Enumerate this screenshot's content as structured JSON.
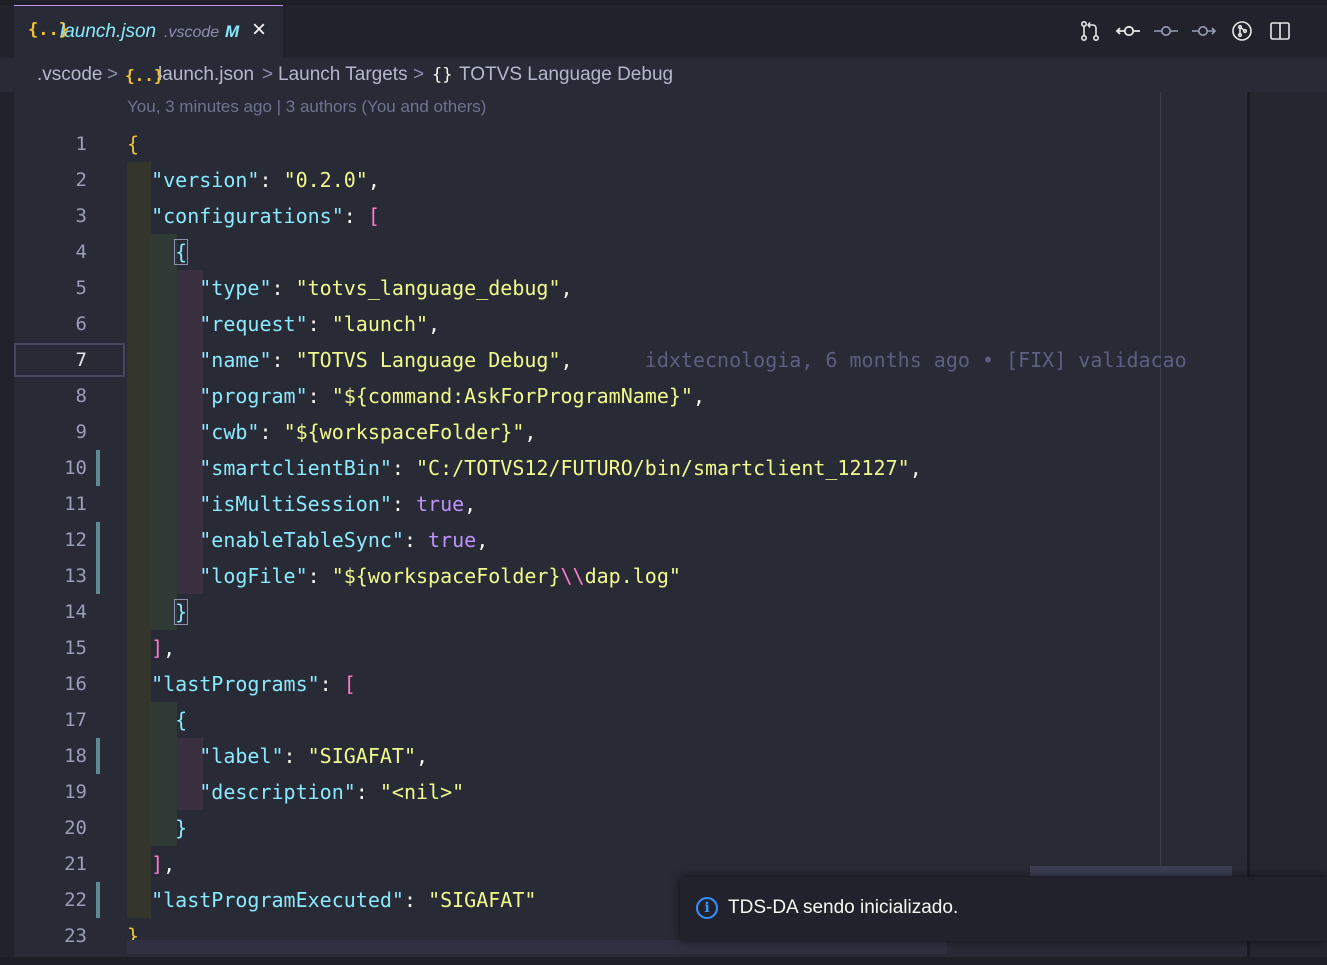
{
  "tab": {
    "icon": "{..}",
    "file": "launch.json",
    "folder": ".vscode",
    "status": "M",
    "close": "×"
  },
  "actions": [
    {
      "name": "open-changes-icon"
    },
    {
      "name": "git-commit-icon"
    },
    {
      "name": "previous-change-icon"
    },
    {
      "name": "next-change-icon"
    },
    {
      "name": "timeline-icon"
    },
    {
      "name": "split-editor-icon"
    }
  ],
  "breadcrumb": {
    "folder": ".vscode",
    "file_icon": "{..}",
    "file": "launch.json",
    "section": "Launch Targets",
    "item_icon": "{}",
    "item": "TOTVS Language Debug",
    "sep": ">"
  },
  "codelens": "You, 3 minutes ago | 3 authors (You and others)",
  "blame": "idxtecnologia, 6 months ago • [FIX] validacao",
  "line_numbers": [
    "1",
    "2",
    "3",
    "4",
    "5",
    "6",
    "7",
    "8",
    "9",
    "10",
    "11",
    "12",
    "13",
    "14",
    "15",
    "16",
    "17",
    "18",
    "19",
    "20",
    "21",
    "22",
    "23"
  ],
  "code": {
    "version_key": "\"version\"",
    "version_val": "\"0.2.0\"",
    "configurations_key": "\"configurations\"",
    "type_key": "\"type\"",
    "type_val": "\"totvs_language_debug\"",
    "request_key": "\"request\"",
    "request_val": "\"launch\"",
    "name_key": "\"name\"",
    "name_val": "\"TOTVS Language Debug\"",
    "program_key": "\"program\"",
    "program_val": "\"${command:AskForProgramName}\"",
    "cwb_key": "\"cwb\"",
    "cwb_val": "\"${workspaceFolder}\"",
    "smartclient_key": "\"smartclientBin\"",
    "smartclient_val": "\"C:/TOTVS12/FUTURO/bin/smartclient_12127\"",
    "multisession_key": "\"isMultiSession\"",
    "multisession_val": "true",
    "tablesync_key": "\"enableTableSync\"",
    "tablesync_val": "true",
    "logfile_key": "\"logFile\"",
    "logfile_val_a": "\"${workspaceFolder}",
    "logfile_esc": "\\\\",
    "logfile_val_b": "dap.log\"",
    "lastprograms_key": "\"lastPrograms\"",
    "label_key": "\"label\"",
    "label_val": "\"SIGAFAT\"",
    "description_key": "\"description\"",
    "description_val": "\"<nil>\"",
    "lastexec_key": "\"lastProgramExecuted\"",
    "lastexec_val": "\"SIGAFAT\""
  },
  "notification": {
    "icon": "i",
    "text": "TDS-DA sendo inicializado."
  }
}
